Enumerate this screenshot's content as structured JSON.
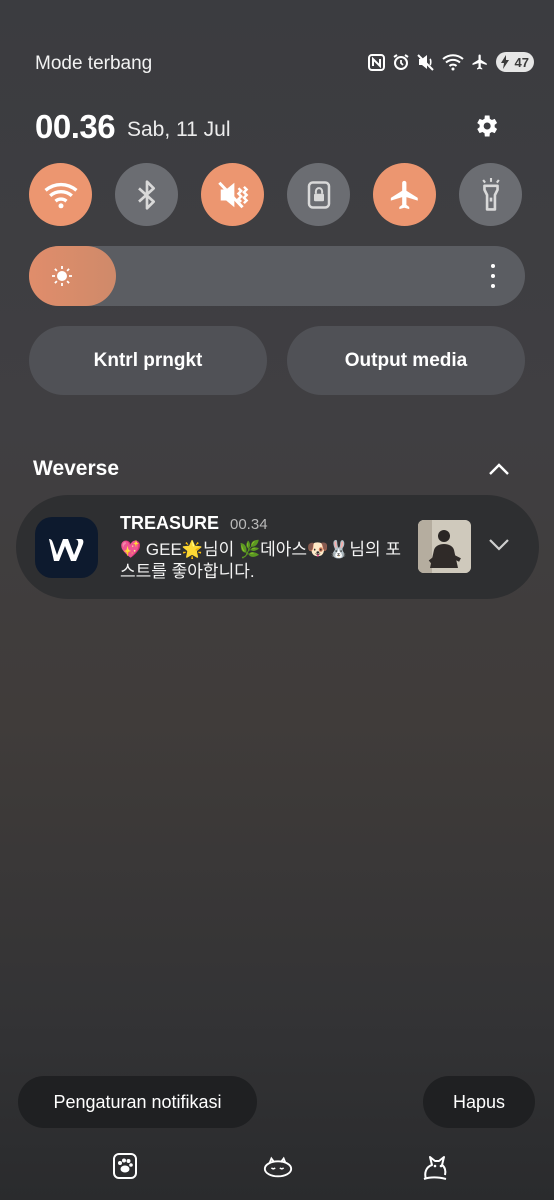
{
  "status_bar": {
    "mode_label": "Mode terbang",
    "icons": [
      "nfc-icon",
      "alarm-icon",
      "mute-icon",
      "wifi-icon",
      "airplane-icon"
    ],
    "battery_level": "47"
  },
  "header": {
    "time": "00.36",
    "date": "Sab, 11 Jul",
    "settings_icon": "gear-icon"
  },
  "quick_toggles": [
    {
      "name": "wifi",
      "icon": "wifi-icon",
      "active": true
    },
    {
      "name": "bluetooth",
      "icon": "bluetooth-icon",
      "active": false
    },
    {
      "name": "sound",
      "icon": "mute-icon",
      "active": true
    },
    {
      "name": "rotation-lock",
      "icon": "lock-icon",
      "active": false
    },
    {
      "name": "airplane-mode",
      "icon": "airplane-icon",
      "active": true
    },
    {
      "name": "flashlight",
      "icon": "flashlight-icon",
      "active": false
    }
  ],
  "brightness": {
    "icon": "sun-icon",
    "level": 0.12
  },
  "shortcuts": {
    "device_control": "Kntrl prngkt",
    "media_output": "Output media"
  },
  "notification": {
    "app_name": "Weverse",
    "title": "TREASURE",
    "time": "00.34",
    "body": "💖 GEE🌟님이 🌿데아스🐶🐰님의 포스트를 좋아합니다."
  },
  "bottom": {
    "settings_button": "Pengaturan notifikasi",
    "clear_button": "Hapus"
  },
  "colors": {
    "accent": "#ec9670",
    "inactive_toggle": "#6b6d72",
    "background": "#3d3d40"
  }
}
